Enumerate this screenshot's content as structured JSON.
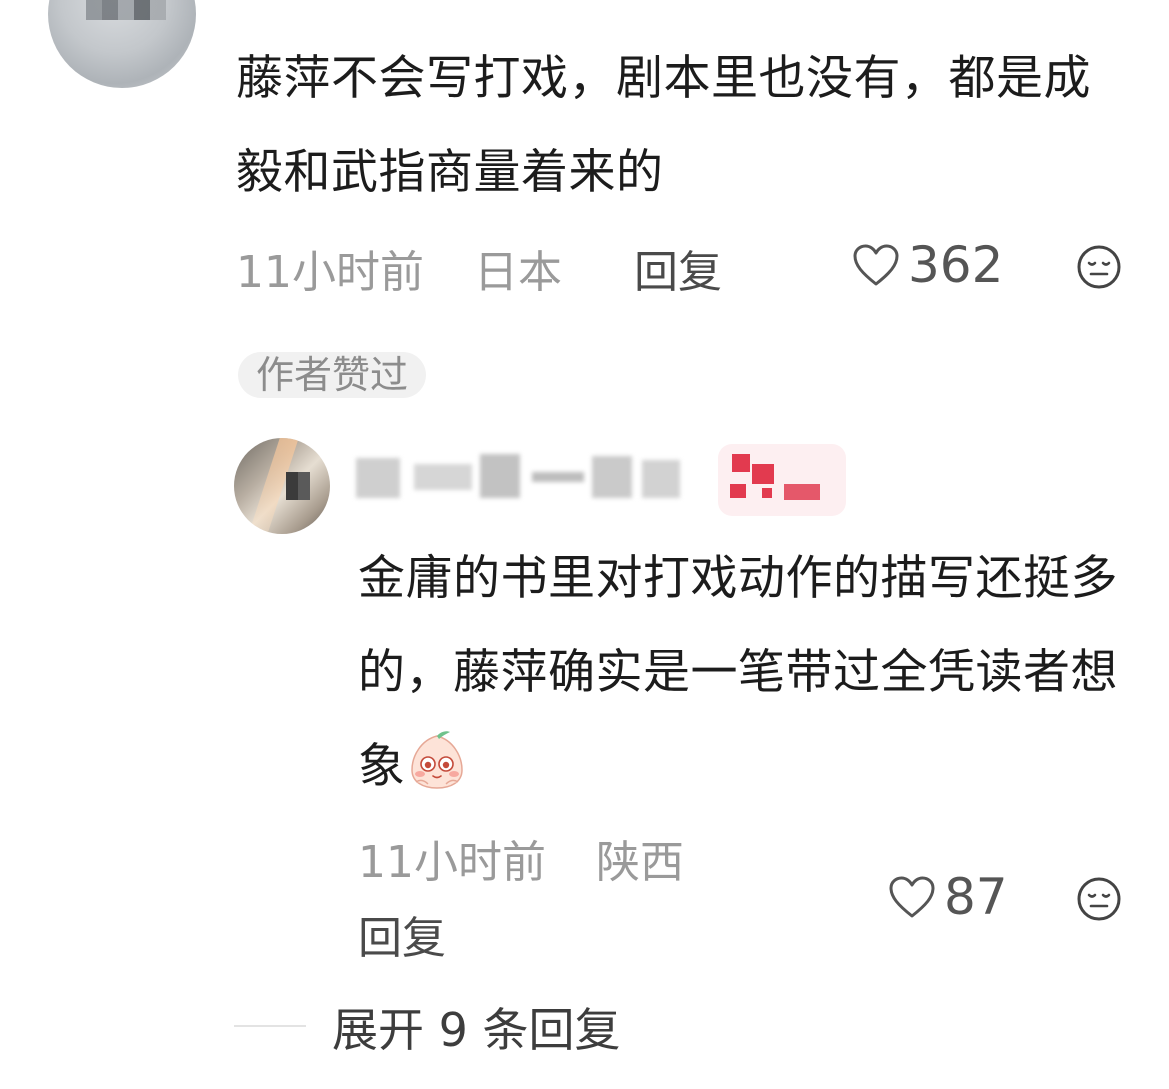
{
  "top_comment": {
    "text": "藤萍不会写打戏，剧本里也没有，都是成毅和武指商量着来的",
    "time": "11小时前",
    "location": "日本",
    "reply_label": "回复",
    "like_count": "362",
    "author_badge": "作者赞过"
  },
  "reply": {
    "text": "金庸的书里对打戏动作的描写还挺多的，藤萍确实是一笔带过全凭读者想象",
    "time": "11小时前",
    "location": "陕西",
    "reply_label": "回复",
    "like_count": "87"
  },
  "expand": {
    "label": "展开 9 条回复"
  },
  "icons": {
    "like": "heart-outline-icon",
    "dislike": "meh-face-icon",
    "emoji": "peach-face-emoji"
  },
  "colors": {
    "meta_text": "#9a9a9a",
    "badge_bg": "#f1f1f1",
    "badge_red": "#e23a4f"
  }
}
